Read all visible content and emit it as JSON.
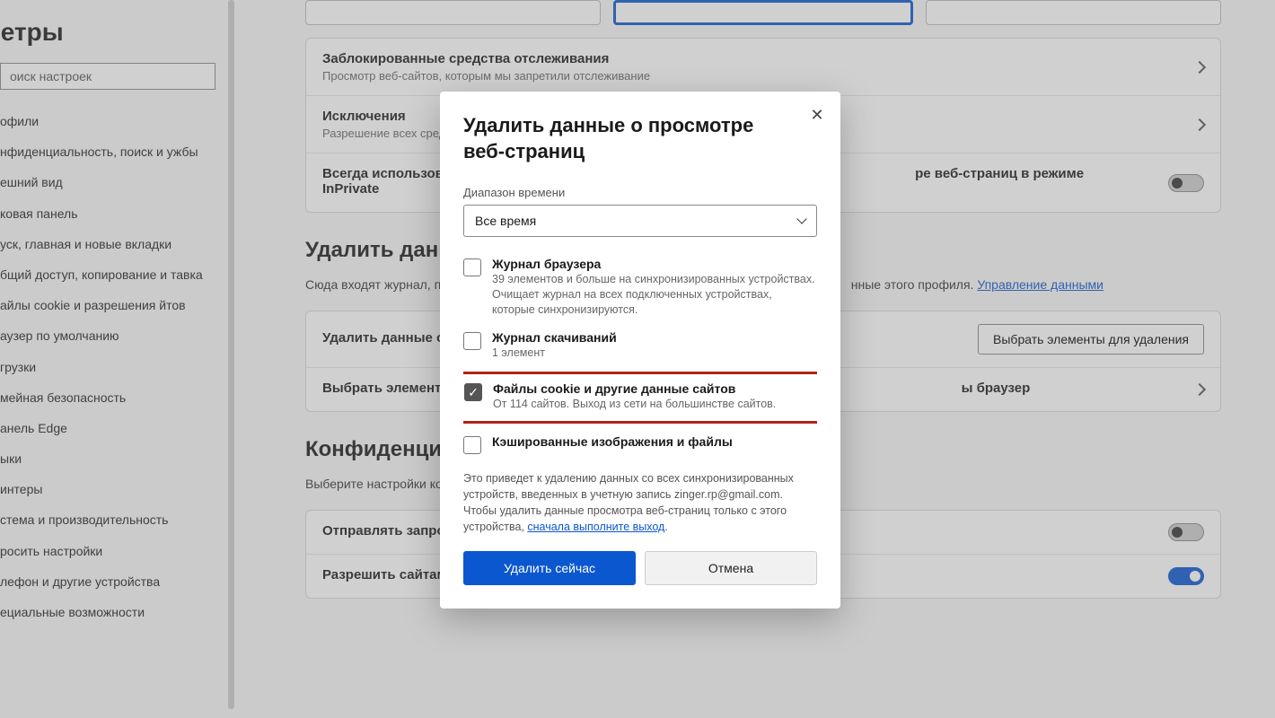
{
  "sidebar": {
    "title": "метры",
    "search_placeholder": "оиск настроек",
    "items": [
      "офили",
      "нфиденциальность, поиск и ужбы",
      "ешний вид",
      "ковая панель",
      "уск, главная и новые вкладки",
      "бщий доступ, копирование и тавка",
      "айлы cookie и разрешения йтов",
      "аузер по умолчанию",
      "грузки",
      "мейная безопасность",
      "анель Edge",
      "ыки",
      "интеры",
      "стема и производительность",
      "росить настройки",
      "лефон и другие устройства",
      "ециальные возможности"
    ]
  },
  "tracking": {
    "r1_title": "Заблокированные средства отслеживания",
    "r1_sub": "Просмотр веб-сайтов, которым мы запретили отслеживание",
    "r2_title": "Исключения",
    "r2_sub": "Разрешение всех средств",
    "r3_title_a": "Всегда использовать",
    "r3_title_b": "ре веб-страниц в режиме",
    "r3_title_c": "InPrivate"
  },
  "clear": {
    "heading": "Удалить данные",
    "desc_a": "Сюда входят журнал, па",
    "desc_b": "нные этого профиля. ",
    "link": "Управление данными",
    "row1": "Удалить данные о пр",
    "row1_btn": "Выбрать элементы для удаления",
    "row2": "Выбрать элементы, к",
    "row2_tail": "ы браузер"
  },
  "privacy": {
    "heading": "Конфиденциаль",
    "desc": "Выберите настройки ко",
    "r1": "Отправлять запросы Не отслеживать",
    "r2": "Разрешить сайтам проверять, есть ли сохраненные методы оплаты"
  },
  "modal": {
    "title": "Удалить данные о просмотре веб-страниц",
    "time_label": "Диапазон времени",
    "time_value": "Все время",
    "items": [
      {
        "title": "Журнал браузера",
        "sub": "39 элементов и больше на синхронизированных устройствах. Очищает журнал на всех подключенных устройствах, которые синхронизируются.",
        "checked": false
      },
      {
        "title": "Журнал скачиваний",
        "sub": "1 элемент",
        "checked": false
      },
      {
        "title": "Файлы cookie и другие данные сайтов",
        "sub": "От 114 сайтов. Выход из сети на большинстве сайтов.",
        "checked": true,
        "highlight": true
      },
      {
        "title": "Кэшированные изображения и файлы",
        "sub": "",
        "checked": false
      }
    ],
    "note_a": "Это приведет к удалению данных со всех синхронизированных устройств, введенных в учетную запись zinger.rp@gmail.com. Чтобы удалить данные просмотра веб-страниц только с этого устройства, ",
    "note_link": "сначала выполните выход",
    "btn_primary": "Удалить сейчас",
    "btn_cancel": "Отмена"
  }
}
